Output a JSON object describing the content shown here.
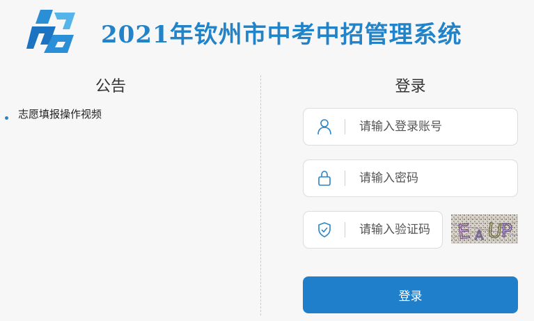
{
  "header": {
    "title": "2021年钦州市中考中招管理系统",
    "logo_icon": "zhaokao-logo-icon",
    "brand_color": "#2283c9"
  },
  "notice": {
    "title": "公告",
    "items": [
      {
        "label": "志愿填报操作视频"
      }
    ]
  },
  "login": {
    "title": "登录",
    "account": {
      "placeholder": "请输入登录账号",
      "value": "",
      "icon": "user-icon"
    },
    "password": {
      "placeholder": "请输入密码",
      "value": "",
      "icon": "lock-icon"
    },
    "captcha": {
      "placeholder": "请输入验证码",
      "value": "",
      "icon": "shield-check-icon",
      "image_text": "EAUP"
    },
    "submit_label": "登录",
    "button_color": "#1f7fcb"
  }
}
